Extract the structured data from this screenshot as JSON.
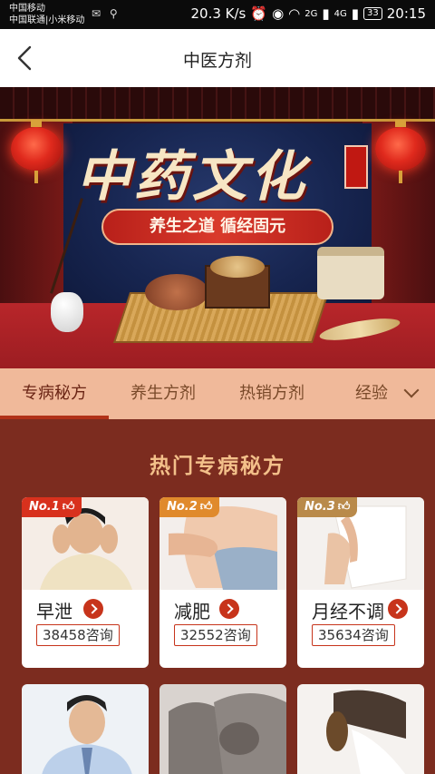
{
  "status_bar": {
    "carrier_1": "中国移动",
    "carrier_2": "中国联通|小米移动",
    "speed": "20.3 K/s",
    "net_1": "2G",
    "net_2": "4G",
    "battery": "33",
    "time": "20:15"
  },
  "nav": {
    "title": "中医方剂"
  },
  "banner": {
    "title": "中药文化",
    "slogan": "养生之道  循经固元"
  },
  "tabs": [
    {
      "label": "专病秘方",
      "active": true
    },
    {
      "label": "养生方剂",
      "active": false
    },
    {
      "label": "热销方剂",
      "active": false
    },
    {
      "label": "经验",
      "active": false
    }
  ],
  "section": {
    "title": "热门专病秘方"
  },
  "cards": [
    {
      "rank": "No.1",
      "name": "早泄",
      "count": "38458咨询",
      "rank_color": "#d8311d"
    },
    {
      "rank": "No.2",
      "name": "减肥",
      "count": "32552咨询",
      "rank_color": "#e08a2c"
    },
    {
      "rank": "No.3",
      "name": "月经不调",
      "count": "35634咨询",
      "rank_color": "#b98a4a"
    }
  ],
  "colors": {
    "accent": "#c7341b",
    "background": "#7c2c1f",
    "tab_bar": "#f0b99a",
    "section_title": "#f3c08a"
  }
}
